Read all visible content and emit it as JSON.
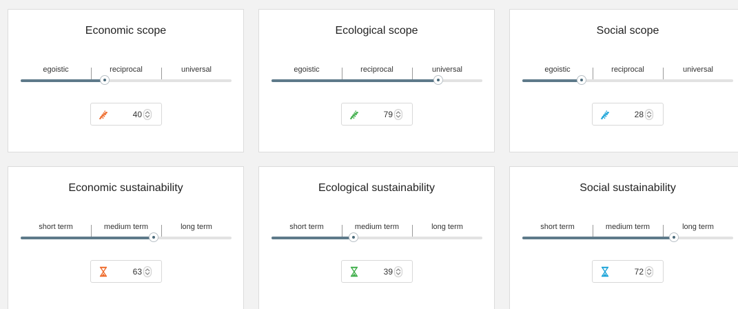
{
  "panels": [
    {
      "title": "Economic scope",
      "ticks": [
        "egoistic",
        "reciprocal",
        "universal"
      ],
      "value": 40,
      "level_percent": 40,
      "icon": "stairs-icon",
      "icon_color": "#ee6a2a"
    },
    {
      "title": "Ecological scope",
      "ticks": [
        "egoistic",
        "reciprocal",
        "universal"
      ],
      "value": 79,
      "level_percent": 79,
      "icon": "stairs-icon",
      "icon_color": "#3fae4a"
    },
    {
      "title": "Social scope",
      "ticks": [
        "egoistic",
        "reciprocal",
        "universal"
      ],
      "value": 28,
      "level_percent": 28,
      "icon": "stairs-icon",
      "icon_color": "#1aa3d8"
    },
    {
      "title": "Economic sustainability",
      "ticks": [
        "short term",
        "medium term",
        "long term"
      ],
      "value": 63,
      "level_percent": 63,
      "icon": "hourglass-icon",
      "icon_color": "#ee6a2a"
    },
    {
      "title": "Ecological sustainability",
      "ticks": [
        "short term",
        "medium term",
        "long term"
      ],
      "value": 39,
      "level_percent": 39,
      "icon": "hourglass-icon",
      "icon_color": "#3fae4a"
    },
    {
      "title": "Social sustainability",
      "ticks": [
        "short term",
        "medium term",
        "long term"
      ],
      "value": 72,
      "level_percent": 72,
      "icon": "hourglass-icon",
      "icon_color": "#1aa3d8"
    }
  ],
  "colors": {
    "slider_fill": "#5e7a8a",
    "slider_track": "#e2e2e2",
    "page_background": "#f2f2f2"
  }
}
